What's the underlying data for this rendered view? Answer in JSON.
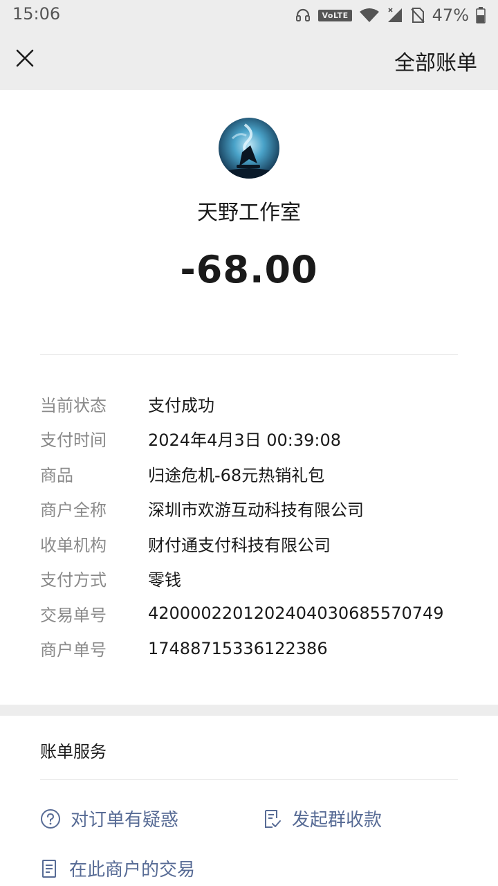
{
  "status_bar": {
    "time": "15:06",
    "volte": "VoLTE",
    "battery": "47%",
    "icons": [
      "headphones-icon",
      "volte-icon",
      "wifi-icon",
      "signal-icon",
      "no-sim-icon",
      "battery-icon"
    ]
  },
  "nav": {
    "close_icon": "close-icon",
    "all_bills": "全部账单"
  },
  "merchant": {
    "name": "天野工作室",
    "amount": "-68.00"
  },
  "details": [
    {
      "label": "当前状态",
      "value": "支付成功"
    },
    {
      "label": "支付时间",
      "value": "2024年4月3日 00:39:08"
    },
    {
      "label": "商品",
      "value": "归途危机-68元热销礼包"
    },
    {
      "label": "商户全称",
      "value": "深圳市欢游互动科技有限公司"
    },
    {
      "label": "收单机构",
      "value": "财付通支付科技有限公司"
    },
    {
      "label": "支付方式",
      "value": "零钱"
    },
    {
      "label": "交易单号",
      "value": "4200002201202404030685570749"
    },
    {
      "label": "商户单号",
      "value": "17488715336122386"
    }
  ],
  "services": {
    "title": "账单服务",
    "question_order": "对订单有疑惑",
    "group_collect": "发起群收款",
    "merchant_transactions": "在此商户的交易"
  },
  "colors": {
    "link": "#576b95",
    "label": "#8a8a8a",
    "background_gray": "#ededed"
  }
}
